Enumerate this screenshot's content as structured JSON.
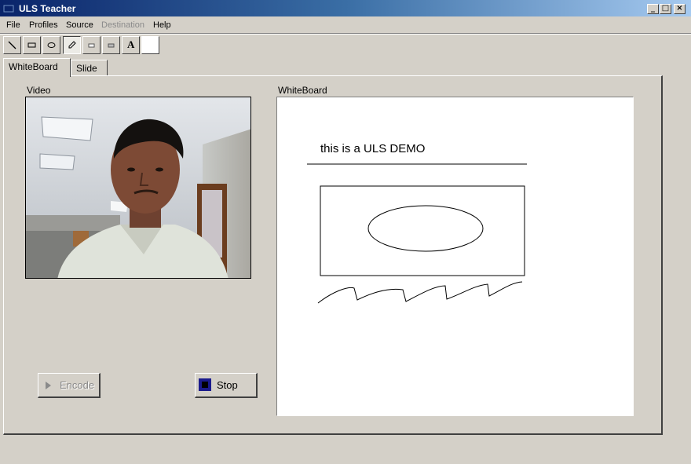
{
  "window": {
    "title": "ULS Teacher",
    "minimize": "_",
    "maximize": "□",
    "close": "×"
  },
  "menu": [
    {
      "label": "File",
      "enabled": true
    },
    {
      "label": "Profiles",
      "enabled": true
    },
    {
      "label": "Source",
      "enabled": true
    },
    {
      "label": "Destination",
      "enabled": false
    },
    {
      "label": "Help",
      "enabled": true
    }
  ],
  "toolbar": {
    "tools": [
      {
        "name": "line-tool",
        "icon": "line-icon"
      },
      {
        "name": "rectangle-tool",
        "icon": "rectangle-icon"
      },
      {
        "name": "ellipse-tool",
        "icon": "ellipse-icon"
      },
      {
        "name": "pen-tool",
        "icon": "pen-icon",
        "active": true
      },
      {
        "name": "eraser-tool",
        "icon": "eraser-icon"
      },
      {
        "name": "fill-tool",
        "icon": "fill-icon"
      },
      {
        "name": "text-tool",
        "icon": "text-icon",
        "glyph": "A"
      },
      {
        "name": "color-tool",
        "icon": "color-swatch-icon",
        "color": "#ffffff"
      }
    ]
  },
  "tabs": [
    {
      "label": "WhiteBoard",
      "active": true
    },
    {
      "label": "Slide",
      "active": false
    }
  ],
  "video": {
    "label": "Video"
  },
  "whiteboard": {
    "label": "WhiteBoard",
    "text": "this is a ULS DEMO"
  },
  "buttons": {
    "encode": {
      "label": "Encode",
      "enabled": false
    },
    "stop": {
      "label": "Stop",
      "enabled": true
    }
  },
  "colors": {
    "title_start": "#0a246a",
    "title_end": "#a6caf0",
    "face": "#d4d0c8",
    "stop_icon": "#1a1a8c"
  }
}
